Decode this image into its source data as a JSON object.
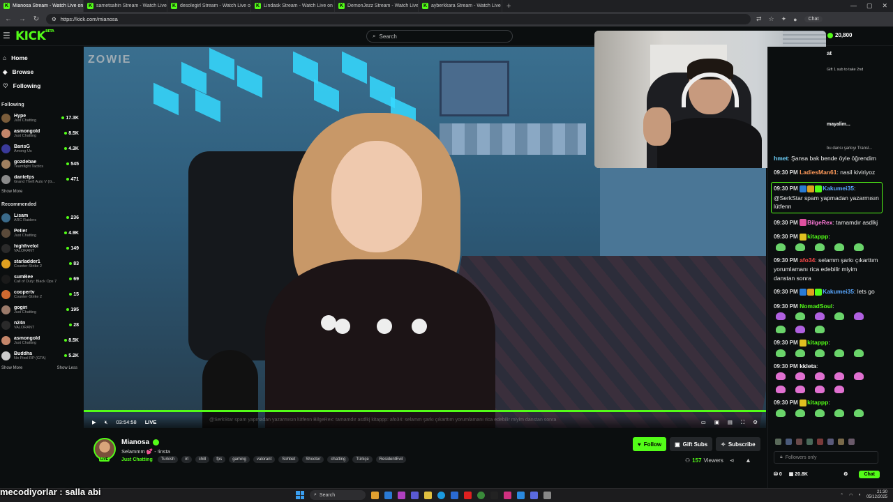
{
  "browser": {
    "tabs": [
      {
        "title": "Mianosa Stream - Watch Live on",
        "active": true
      },
      {
        "title": "sametsahin Stream - Watch Live o",
        "active": false
      },
      {
        "title": "desolegirl Stream - Watch Live o",
        "active": false
      },
      {
        "title": "Lindask Stream - Watch Live on K",
        "active": false
      },
      {
        "title": "DemonJezz Stream - Watch Live o",
        "active": false
      },
      {
        "title": "ayberkkara Stream - Watch Live o",
        "active": false
      }
    ],
    "url": "https://kick.com/mianosa",
    "chat_label": "Chat"
  },
  "header": {
    "logo": "KICK",
    "logo_beta": "BETA",
    "search_placeholder": "Search",
    "points": "20,800"
  },
  "sidebar": {
    "nav": [
      {
        "label": "Home",
        "icon": "home-icon"
      },
      {
        "label": "Browse",
        "icon": "compass-icon"
      },
      {
        "label": "Following",
        "icon": "heart-icon"
      }
    ],
    "following_title": "Following",
    "following": [
      {
        "name": "Hype",
        "category": "Just Chatting",
        "viewers": "17.3K",
        "color": "#7a5c3a"
      },
      {
        "name": "asmongold",
        "category": "Just Chatting",
        "viewers": "8.5K",
        "color": "#c4866a"
      },
      {
        "name": "BarisG",
        "category": "Among Us",
        "viewers": "4.3K",
        "color": "#3a3a9a"
      },
      {
        "name": "gozdebae",
        "category": "Teamfight Tactics",
        "viewers": "545",
        "color": "#a08060"
      },
      {
        "name": "dantefps",
        "category": "Grand Theft Auto V (G...",
        "viewers": "471",
        "color": "#8a8a8a"
      }
    ],
    "show_more": "Show More",
    "recommended_title": "Recommended",
    "recommended": [
      {
        "name": "Lisam",
        "category": "ARC Raiders",
        "viewers": "236",
        "color": "#3a6a8a"
      },
      {
        "name": "Peller",
        "category": "Just Chatting",
        "viewers": "4.9K",
        "color": "#5a4a3a"
      },
      {
        "name": "highfivelol",
        "category": "VALORANT",
        "viewers": "149",
        "color": "#2a2a2a"
      },
      {
        "name": "starladder1",
        "category": "Counter-Strike 2",
        "viewers": "83",
        "color": "#e0a020"
      },
      {
        "name": "sumBee",
        "category": "Call of Duty: Black Ops 7",
        "viewers": "69",
        "color": "#1a1a1a"
      },
      {
        "name": "coopertv",
        "category": "Counter-Strike 2",
        "viewers": "15",
        "color": "#d06a30"
      },
      {
        "name": "gogiri",
        "category": "Just Chatting",
        "viewers": "195",
        "color": "#9a7a6a"
      },
      {
        "name": "n24n",
        "category": "VALORANT",
        "viewers": "28",
        "color": "#2a2a2a"
      },
      {
        "name": "asmongold",
        "category": "Just Chatting",
        "viewers": "8.5K",
        "color": "#c4866a"
      },
      {
        "name": "Buddha",
        "category": "No Pixel RP (GTA)",
        "viewers": "5.2K",
        "color": "#ccc"
      }
    ],
    "show_more_2": "Show More",
    "show_less": "Show Less"
  },
  "video": {
    "watermark": "ZOWIE",
    "time": "03:54:58",
    "live_label": "LIVE",
    "ticker": "@SerkStar spam yapmadan yazarmısın lütfenn    BilgeRex: tamamdır asdlkj    kitappp:      afo34: selamm şarkı çıkarttım yorumlamanı rica edebilir miyim danstan sonra"
  },
  "stream_info": {
    "name": "Mianosa",
    "title": "Selammm 💕 - !insta",
    "category": "Just Chatting",
    "tags": [
      "Turkish",
      "irl",
      "chill",
      "fps",
      "gaming",
      "valorant",
      "Sohbet",
      "Shooter",
      "chatting",
      "Türkçe",
      "ResidentEvil"
    ],
    "live_badge": "LIVE",
    "follow_label": "Follow",
    "gift_label": "Gift Subs",
    "subscribe_label": "Subscribe",
    "viewers": "157",
    "viewers_label": "Viewers"
  },
  "chat": {
    "header_partial": "at",
    "gift_text": "Gift 1 sub to take 2nd",
    "pinned_partial": "mayalim...",
    "pinned_sub": "bu dansı şarkıyı Transl...",
    "messages": [
      {
        "time": "",
        "user": "hmet",
        "user_color": "#6fd4ff",
        "text": "Şansa bak bende öyle öğrendim",
        "partial": true
      },
      {
        "time": "09:30 PM",
        "user": "LadiesMan61",
        "user_color": "#ff9a5a",
        "text": "nasil kiviriyoz"
      },
      {
        "time": "09:30 PM",
        "user": "Kakumei35",
        "user_color": "#5aa8ff",
        "text": "@SerkStar spam yapmadan yazarmısın lütfenn",
        "highlight": true,
        "badges": [
          "#2a7bd4",
          "#e0a020",
          "#53fc18"
        ]
      },
      {
        "time": "09:30 PM",
        "user": "BilgeRex",
        "user_color": "#ff7ad9",
        "text": "tamamdır asdlkj",
        "badges": [
          "#e050a0"
        ]
      },
      {
        "time": "09:30 PM",
        "user": "kitappp",
        "user_color": "#53fc18",
        "text": "",
        "badges": [
          "#e0c020"
        ],
        "emotes": 5
      },
      {
        "time": "09:30 PM",
        "user": "afo34",
        "user_color": "#ff4a4a",
        "text": "selamm şarkı çıkarttım yorumlamanı rica edebilir miyim danstan sonra"
      },
      {
        "time": "09:30 PM",
        "user": "Kakumei35",
        "user_color": "#5aa8ff",
        "text": "lets go",
        "badges": [
          "#2a7bd4",
          "#e0a020",
          "#53fc18"
        ]
      },
      {
        "time": "09:30 PM",
        "user": "NomadSoul",
        "user_color": "#53fc18",
        "text": "",
        "emotes": 8
      },
      {
        "time": "09:30 PM",
        "user": "kitappp",
        "user_color": "#53fc18",
        "text": "",
        "badges": [
          "#e0c020"
        ],
        "emotes": 5
      },
      {
        "time": "09:30 PM",
        "user": "kkleta",
        "user_color": "#ffffff",
        "text": "",
        "emotes": 9
      },
      {
        "time": "09:30 PM",
        "user": "kitappp",
        "user_color": "#53fc18",
        "text": "",
        "badges": [
          "#e0c020"
        ],
        "emotes": 5
      }
    ],
    "input_placeholder": "Followers only",
    "points": "0",
    "sub_count": "20.8K",
    "send_label": "Chat"
  },
  "caption": "mecodiyorlar : salla abi",
  "taskbar": {
    "search": "Search",
    "time": "21:30",
    "date": "05/12/2025"
  }
}
